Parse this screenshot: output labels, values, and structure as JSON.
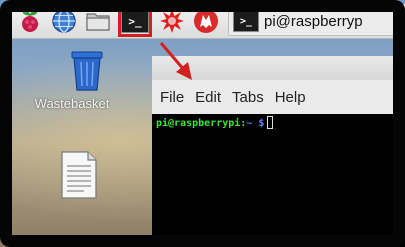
{
  "taskbar": {
    "launchers": [
      {
        "icon": "raspberry-menu-icon"
      },
      {
        "icon": "web-browser-globe-icon"
      },
      {
        "icon": "file-manager-folder-icon"
      },
      {
        "icon": "terminal-icon",
        "highlighted": true,
        "glyph": ">_"
      },
      {
        "icon": "mathematica-star-icon"
      },
      {
        "icon": "wolfram-icon"
      }
    ],
    "task": {
      "icon": "terminal-icon",
      "glyph": ">_",
      "label": "pi@raspberryp"
    }
  },
  "desktop": {
    "icons": [
      {
        "icon": "wastebasket-icon",
        "label": "Wastebasket"
      },
      {
        "icon": "text-file-icon",
        "label": ""
      }
    ]
  },
  "terminal": {
    "menu": [
      "File",
      "Edit",
      "Tabs",
      "Help"
    ],
    "prompt": {
      "user_host": "pi@raspberrypi:",
      "path": "~ $"
    }
  },
  "colors": {
    "highlight": "#d42020",
    "prompt_user": "#39e639",
    "prompt_path": "#5b7cff"
  }
}
